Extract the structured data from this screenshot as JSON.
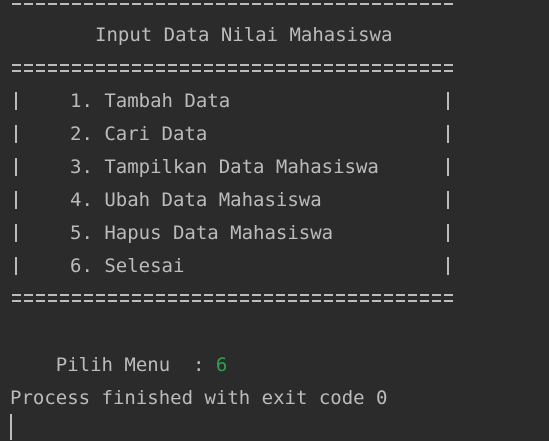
{
  "console": {
    "title": "Input Data Nilai Mahasiswa",
    "menu_items": [
      "1. Tambah Data",
      "2. Cari Data",
      "3. Tampilkan Data Mahasiswa",
      "4. Ubah Data Mahasiswa",
      "5. Hapus Data Mahasiswa",
      "6. Selesai"
    ],
    "prompt_label": "Pilih Menu  : ",
    "input_value": "6",
    "process_message": "Process finished with exit code 0",
    "colors": {
      "background": "#2b2b2b",
      "text": "#bbbbbb",
      "input": "#2f9f4f"
    }
  }
}
